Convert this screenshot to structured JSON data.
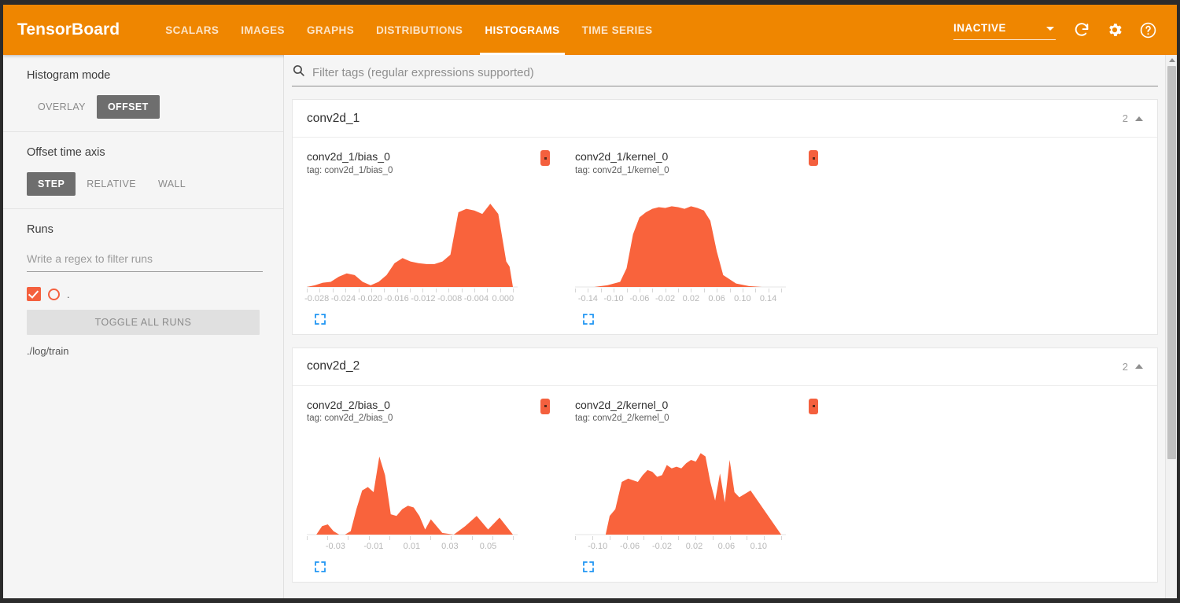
{
  "header": {
    "brand": "TensorBoard",
    "tabs": [
      {
        "label": "SCALARS",
        "active": false
      },
      {
        "label": "IMAGES",
        "active": false
      },
      {
        "label": "GRAPHS",
        "active": false
      },
      {
        "label": "DISTRIBUTIONS",
        "active": false
      },
      {
        "label": "HISTOGRAMS",
        "active": true
      },
      {
        "label": "TIME SERIES",
        "active": false
      }
    ],
    "status": "INACTIVE",
    "icons": [
      "refresh-icon",
      "gear-icon",
      "help-icon"
    ],
    "accent_color": "#ef8600"
  },
  "sidebar": {
    "histogram_mode": {
      "title": "Histogram mode",
      "options": [
        "OVERLAY",
        "OFFSET"
      ],
      "selected": "OFFSET"
    },
    "offset_time_axis": {
      "title": "Offset time axis",
      "options": [
        "STEP",
        "RELATIVE",
        "WALL"
      ],
      "selected": "STEP"
    },
    "runs": {
      "title": "Runs",
      "filter_placeholder": "Write a regex to filter runs",
      "filter_value": "",
      "run_marker_label": ".",
      "toggle_all_label": "TOGGLE ALL RUNS",
      "run_path": "./log/train",
      "checkbox_checked": true,
      "run_color": "#f4603e"
    }
  },
  "main": {
    "filter": {
      "placeholder": "Filter tags (regular expressions supported)",
      "value": ""
    },
    "groups": [
      {
        "name": "conv2d_1",
        "count": "2",
        "expanded": true,
        "charts": [
          {
            "title": "conv2d_1/bias_0",
            "tag": "tag: conv2d_1/bias_0",
            "chart_ref": 0
          },
          {
            "title": "conv2d_1/kernel_0",
            "tag": "tag: conv2d_1/kernel_0",
            "chart_ref": 1
          }
        ]
      },
      {
        "name": "conv2d_2",
        "count": "2",
        "expanded": true,
        "charts": [
          {
            "title": "conv2d_2/bias_0",
            "tag": "tag: conv2d_2/bias_0",
            "chart_ref": 2
          },
          {
            "title": "conv2d_2/kernel_0",
            "tag": "tag: conv2d_2/kernel_0",
            "chart_ref": 3
          }
        ]
      }
    ]
  },
  "chart_data": [
    {
      "type": "area",
      "title": "conv2d_1/bias_0",
      "xlabel": "",
      "ylabel": "",
      "grid": false,
      "legend": null,
      "color": "#f9633c",
      "xlim": [
        -0.0295,
        0.0015
      ],
      "tick_labels": [
        "-0.028",
        "-0.024",
        "-0.020",
        "-0.016",
        "-0.012",
        "-0.008",
        "-0.004",
        "0.000"
      ],
      "tick_values": [
        -0.028,
        -0.024,
        -0.02,
        -0.016,
        -0.012,
        -0.008,
        -0.004,
        0.0
      ],
      "minor_tick_count": 17,
      "x": [
        -0.0295,
        -0.0283,
        -0.0271,
        -0.0259,
        -0.0247,
        -0.0235,
        -0.0223,
        -0.0211,
        -0.0199,
        -0.0187,
        -0.0175,
        -0.0163,
        -0.0151,
        -0.0139,
        -0.0127,
        -0.0115,
        -0.0103,
        -0.0091,
        -0.0079,
        -0.0067,
        -0.0055,
        -0.0043,
        -0.0031,
        -0.0019,
        -0.0007,
        0.0005,
        0.001,
        0.0015
      ],
      "values": [
        0.0,
        0.02,
        0.05,
        0.06,
        0.12,
        0.16,
        0.14,
        0.06,
        0.02,
        0.06,
        0.14,
        0.28,
        0.34,
        0.3,
        0.28,
        0.27,
        0.27,
        0.3,
        0.38,
        0.88,
        0.92,
        0.9,
        0.86,
        0.98,
        0.86,
        0.3,
        0.24,
        0.0
      ]
    },
    {
      "type": "area",
      "title": "conv2d_1/kernel_0",
      "xlabel": "",
      "ylabel": "",
      "grid": false,
      "legend": null,
      "color": "#f9633c",
      "xlim": [
        -0.16,
        0.16
      ],
      "tick_labels": [
        "-0.14",
        "-0.10",
        "-0.06",
        "-0.02",
        "0.02",
        "0.06",
        "0.10",
        "0.14"
      ],
      "tick_values": [
        -0.14,
        -0.1,
        -0.06,
        -0.02,
        0.02,
        0.06,
        0.1,
        0.14
      ],
      "minor_tick_count": 17,
      "x": [
        -0.16,
        -0.13,
        -0.11,
        -0.09,
        -0.08,
        -0.07,
        -0.06,
        -0.05,
        -0.04,
        -0.03,
        -0.02,
        -0.01,
        0.0,
        0.01,
        0.02,
        0.03,
        0.04,
        0.05,
        0.06,
        0.07,
        0.09,
        0.11,
        0.13,
        0.16
      ],
      "values": [
        0.0,
        0.0,
        0.02,
        0.06,
        0.22,
        0.62,
        0.82,
        0.88,
        0.92,
        0.94,
        0.93,
        0.95,
        0.94,
        0.92,
        0.95,
        0.93,
        0.9,
        0.78,
        0.42,
        0.14,
        0.04,
        0.01,
        0.0,
        0.0
      ]
    },
    {
      "type": "area",
      "title": "conv2d_2/bias_0",
      "xlabel": "",
      "ylabel": "",
      "grid": false,
      "legend": null,
      "color": "#f9633c",
      "xlim": [
        -0.045,
        0.063
      ],
      "tick_labels": [
        "-0.03",
        "-0.01",
        "0.01",
        "0.03",
        "0.05"
      ],
      "tick_values": [
        -0.03,
        -0.01,
        0.01,
        0.03,
        0.05
      ],
      "minor_tick_count": 11,
      "x": [
        -0.045,
        -0.04,
        -0.037,
        -0.034,
        -0.031,
        -0.028,
        -0.025,
        -0.022,
        -0.019,
        -0.016,
        -0.013,
        -0.01,
        -0.007,
        -0.004,
        -0.001,
        0.002,
        0.005,
        0.008,
        0.011,
        0.014,
        0.017,
        0.02,
        0.026,
        0.032,
        0.038,
        0.044,
        0.05,
        0.056,
        0.063
      ],
      "values": [
        0.0,
        0.0,
        0.1,
        0.12,
        0.04,
        0.0,
        0.0,
        0.04,
        0.3,
        0.52,
        0.56,
        0.5,
        0.92,
        0.7,
        0.24,
        0.22,
        0.3,
        0.34,
        0.32,
        0.22,
        0.06,
        0.18,
        0.02,
        0.0,
        0.1,
        0.22,
        0.06,
        0.2,
        0.0
      ]
    },
    {
      "type": "area",
      "title": "conv2d_2/kernel_0",
      "xlabel": "",
      "ylabel": "",
      "grid": false,
      "legend": null,
      "color": "#f9633c",
      "xlim": [
        -0.128,
        0.128
      ],
      "tick_labels": [
        "-0.10",
        "-0.06",
        "-0.02",
        "0.02",
        "0.06",
        "0.10"
      ],
      "tick_values": [
        -0.1,
        -0.06,
        -0.02,
        0.02,
        0.06,
        0.1
      ],
      "minor_tick_count": 13,
      "x": [
        -0.128,
        -0.09,
        -0.085,
        -0.078,
        -0.07,
        -0.062,
        -0.056,
        -0.05,
        -0.044,
        -0.038,
        -0.032,
        -0.026,
        -0.02,
        -0.014,
        -0.008,
        -0.002,
        0.004,
        0.01,
        0.016,
        0.022,
        0.028,
        0.034,
        0.04,
        0.046,
        0.052,
        0.058,
        0.064,
        0.07,
        0.076,
        0.09,
        0.128
      ],
      "values": [
        0.0,
        0.0,
        0.22,
        0.3,
        0.62,
        0.66,
        0.64,
        0.62,
        0.7,
        0.76,
        0.74,
        0.68,
        0.7,
        0.82,
        0.78,
        0.8,
        0.78,
        0.84,
        0.88,
        0.86,
        0.96,
        0.92,
        0.62,
        0.4,
        0.72,
        0.38,
        0.88,
        0.5,
        0.44,
        0.52,
        0.0
      ]
    }
  ],
  "scrollbar": {
    "visible": true
  }
}
